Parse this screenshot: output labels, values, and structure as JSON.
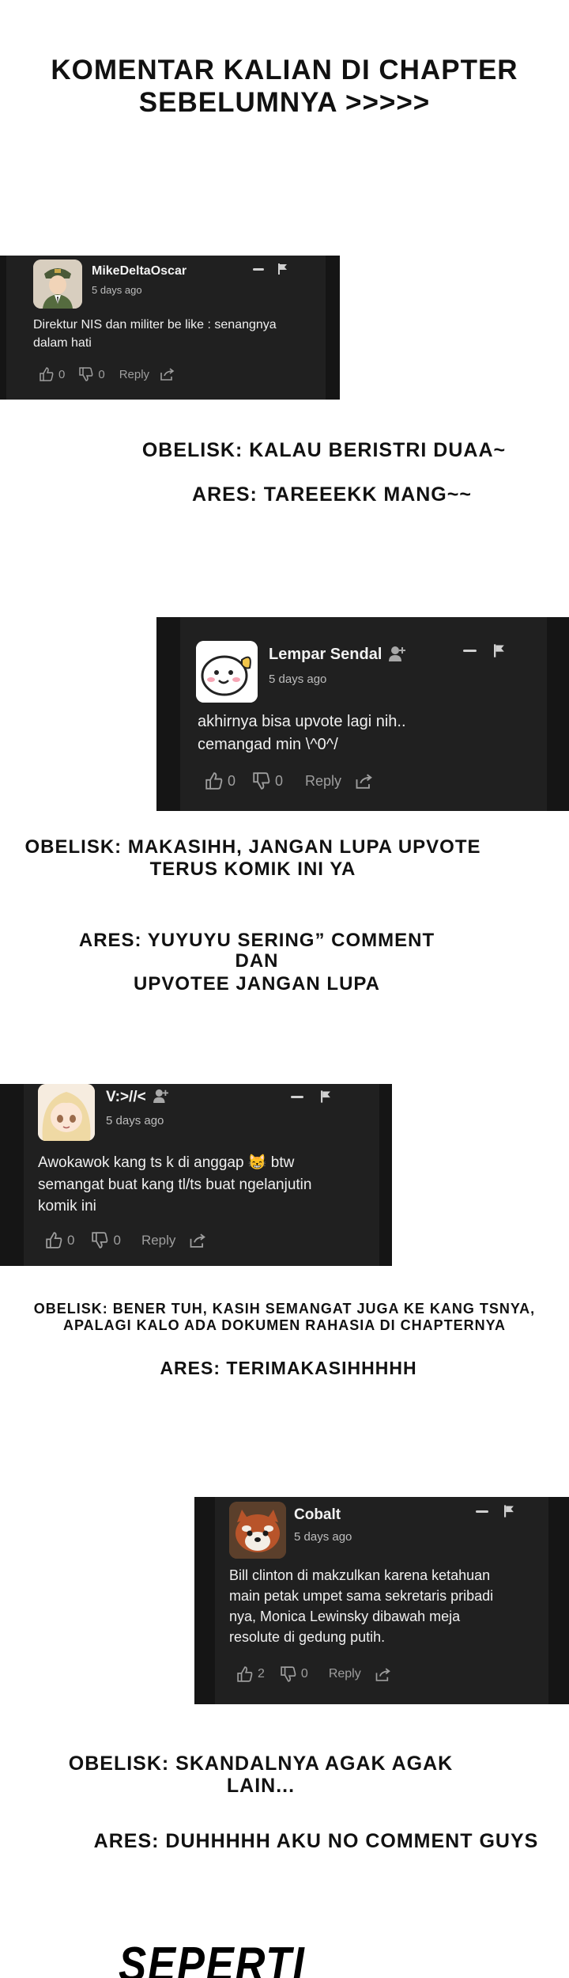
{
  "header": {
    "line1": "KOMENTAR KALIAN DI CHAPTER",
    "line2": "SEBELUMNYA >>>>>"
  },
  "comments": [
    {
      "user": "MikeDeltaOscar",
      "time": "5 days ago",
      "text_line1": "Direktur NIS dan militer be like : senangnya",
      "text_line2": "dalam hati",
      "text_line3": "",
      "text_line4": "",
      "likes": "0",
      "dislikes": "0",
      "reply_label": "Reply",
      "avatar_icon": "soldier-avatar"
    },
    {
      "user": "Lempar Sendal",
      "time": "5 days ago",
      "text_line1": "akhirnya bisa upvote lagi nih..",
      "text_line2": "cemangad min \\^0^/",
      "text_line3": "",
      "text_line4": "",
      "likes": "0",
      "dislikes": "0",
      "reply_label": "Reply",
      "avatar_icon": "cartoon-mascot-avatar"
    },
    {
      "user": "V:>//<",
      "time": "5 days ago",
      "text_line1": "Awokawok kang ts k di anggap 😸 btw",
      "text_line2": "semangat buat kang tl/ts buat ngelanjutin",
      "text_line3": "komik ini",
      "text_line4": "",
      "likes": "0",
      "dislikes": "0",
      "reply_label": "Reply",
      "avatar_icon": "anime-girl-avatar"
    },
    {
      "user": "Cobalt",
      "time": "5 days ago",
      "text_line1": "Bill clinton di makzulkan karena ketahuan",
      "text_line2": "main petak umpet sama sekretaris pribadi",
      "text_line3": "nya, Monica Lewinsky dibawah meja",
      "text_line4": "resolute di gedung putih.",
      "likes": "2",
      "dislikes": "0",
      "reply_label": "Reply",
      "avatar_icon": "red-panda-avatar"
    }
  ],
  "responses": {
    "r1": "OBELISK: KALAU BERISTRI DUAA~",
    "r2": "ARES: TAREEEKK MANG~~",
    "r3a": "OBELISK: MAKASIHH, JANGAN LUPA UPVOTE",
    "r3b": "TERUS KOMIK INI YA",
    "r4a": "ARES: YUYUYU SERING” COMMENT DAN",
    "r4b": "UPVOTEE JANGAN LUPA",
    "r5a": "OBELISK: BENER TUH, KASIH SEMANGAT JUGA KE KANG TSNYA,",
    "r5b": "APALAGI KALO ADA DOKUMEN RAHASIA DI CHAPTERNYA",
    "r6": "ARES: TERIMAKASIHHHHH",
    "r7": "OBELISK: SKANDALNYA AGAK AGAK LAIN...",
    "r8": "ARES: DUHHHHH AKU NO COMMENT GUYS"
  },
  "footer": {
    "title": "SEPERTI BIASAAA!!!!"
  },
  "colors": {
    "card_bg": "#202020",
    "card_border": "#151515",
    "page_bg": "#ffffff",
    "text_dark": "#111111"
  }
}
